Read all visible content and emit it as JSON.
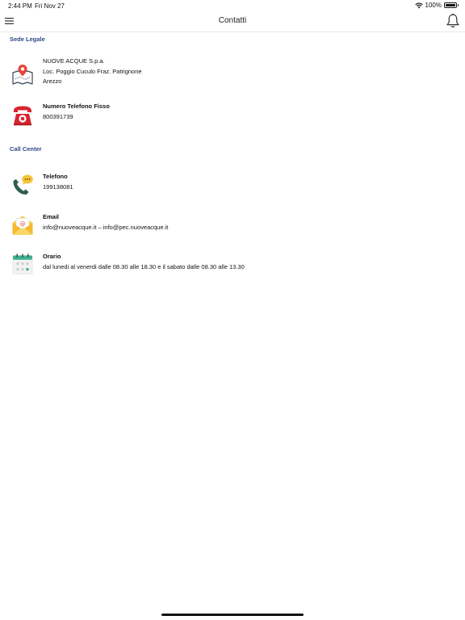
{
  "status_bar": {
    "time": "2:44 PM",
    "date": "Fri Nov 27",
    "battery_text": "100%",
    "battery_level": 1.0,
    "wifi_icon": "wifi-icon",
    "battery_icon": "battery-icon"
  },
  "nav": {
    "title": "Contatti",
    "menu_icon": "hamburger-menu-icon",
    "notifications_icon": "bell-icon"
  },
  "sections": {
    "sede_legale": {
      "header": "Sede Legale",
      "address": {
        "icon": "map-pin-icon",
        "line1": "NUOVE ACQUE S.p.a.",
        "line2": "Loc. Poggio Cuculo Fraz. Patrignone",
        "line3": "Arezzo"
      },
      "landline": {
        "icon": "red-telephone-icon",
        "title": "Numero Telefono Fisso",
        "value": "800391739"
      }
    },
    "call_center": {
      "header": "Call Center",
      "phone": {
        "icon": "phone-chat-icon",
        "title": "Telefono",
        "value": "199138081"
      },
      "email": {
        "icon": "envelope-icon",
        "title": "Email",
        "value": "info@nuoveacque.it – info@pec.nuoveacque.it"
      },
      "hours": {
        "icon": "calendar-icon",
        "title": "Orario",
        "value": "dal lunedi al venerdi dalle 08.30 alle 18.30 e il sabato dalle 08.30 alle 13.30"
      }
    }
  },
  "colors": {
    "section_header": "#2e4a87",
    "phone_red": "#d9232e",
    "pin_red": "#e8443a",
    "chat_yellow": "#f5c33b",
    "phone_green": "#2f5f4f",
    "envelope_yellow": "#f7c948",
    "calendar_green": "#3bb08f"
  }
}
